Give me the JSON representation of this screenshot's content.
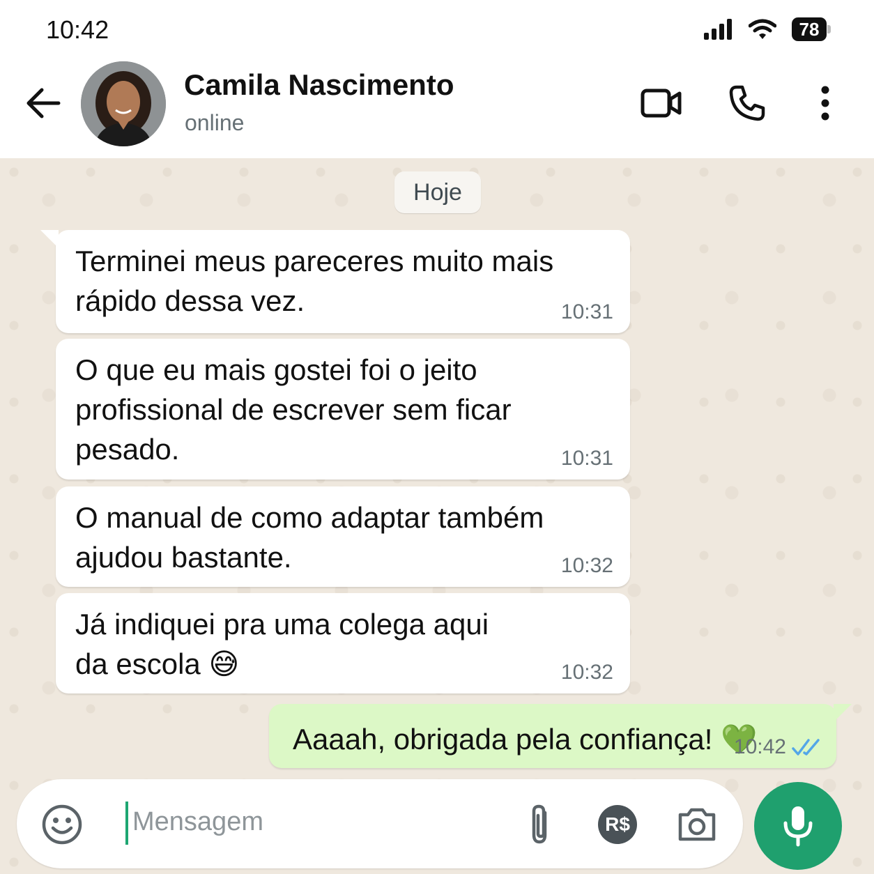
{
  "status_bar": {
    "time": "10:42",
    "battery": "78"
  },
  "header": {
    "contact_name": "Camila Nascimento",
    "contact_status": "online",
    "icons": [
      "back-arrow-icon",
      "video-call-icon",
      "phone-icon",
      "more-vertical-icon"
    ]
  },
  "chat": {
    "date_chip": "Hoje",
    "messages": [
      {
        "direction": "incoming",
        "text": "Terminei meus pareceres muito mais rápido dessa vez.",
        "time": "10:31"
      },
      {
        "direction": "incoming",
        "text": "O que eu mais gostei foi o jeito profissional de escrever sem ficar pesado.",
        "time": "10:31"
      },
      {
        "direction": "incoming",
        "text": "O manual de como adaptar também ajudou bastante.",
        "time": "10:32"
      },
      {
        "direction": "incoming",
        "text": "Já indiquei pra uma colega aqui da escola 😅",
        "time": "10:32"
      },
      {
        "direction": "outgoing",
        "text": "Aaaah, obrigada pela confiança! 💚",
        "time": "10:42",
        "status": "read"
      }
    ]
  },
  "composer": {
    "placeholder": "Mensagem",
    "payment_label": "R$",
    "icons": [
      "emoji-icon",
      "attach-icon",
      "payment-icon",
      "camera-icon",
      "mic-icon"
    ]
  },
  "colors": {
    "accent": "#1fa06e",
    "outgoing_bubble": "#dcf8c6",
    "incoming_bubble": "#ffffff",
    "read_ticks": "#53a6e8"
  }
}
